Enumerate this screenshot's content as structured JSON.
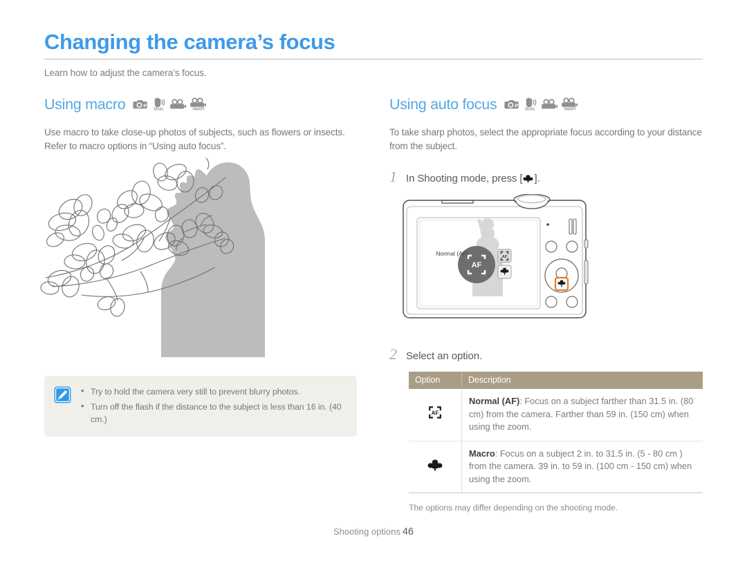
{
  "page": {
    "title": "Changing the camera’s focus",
    "subtitle": "Learn how to adjust the camera’s focus.",
    "accent_color": "#3d9ae9",
    "section_color": "#54a8e3",
    "table_header_color": "#a99d85",
    "note_bg_color": "#f1efe9",
    "highlight_color": "#f07820"
  },
  "mode_icons": [
    {
      "name": "camera-program-icon",
      "label": "P"
    },
    {
      "name": "dual-is-icon",
      "label": "DUAL"
    },
    {
      "name": "movie-icon",
      "label": ""
    },
    {
      "name": "smart-movie-icon",
      "label": "SMART"
    }
  ],
  "left": {
    "section_title": "Using macro",
    "body": "Use macro to take close-up photos of subjects, such as flowers or insects. Refer to macro options in “Using auto focus”.",
    "illustration": "magnolia-branch-with-photographer-silhouette",
    "note": {
      "icon": "note-pen-icon",
      "bullets": [
        "Try to hold the camera very still to prevent blurry photos.",
        "Turn off the flash if the distance to the subject is less than 16 in. (40 cm.)"
      ]
    }
  },
  "right": {
    "section_title": "Using auto focus",
    "body": "To take sharp photos, select the appropriate focus according to your distance from the subject.",
    "steps": [
      {
        "num": "1",
        "text_before": "In Shooting mode, press [",
        "icon": "macro-flower-icon",
        "text_after": "]."
      },
      {
        "num": "2",
        "text_before": "Select an option.",
        "icon": "",
        "text_after": ""
      }
    ],
    "camera": {
      "lcd_label": "Normal (AF)",
      "lcd_selected_icon": "af-frame-icon",
      "lcd_options": [
        "af-frame-icon",
        "macro-flower-icon"
      ],
      "highlighted_button": "macro-button",
      "highlighted_button_icon": "macro-flower-icon"
    },
    "table": {
      "headers": [
        "Option",
        "Description"
      ],
      "rows": [
        {
          "icon": "af-frame-icon",
          "name": "Normal (AF)",
          "separator": ": ",
          "description": "Focus on a subject farther than 31.5 in. (80 cm) from the camera. Farther than 59 in. (150 cm) when using the zoom."
        },
        {
          "icon": "macro-flower-icon",
          "name": "Macro",
          "separator": ": ",
          "description": "Focus on a subject 2 in. to 31.5 in. (5 - 80 cm ) from the camera. 39 in. to 59 in. (100 cm - 150 cm) when using the zoom."
        }
      ],
      "footnote": "The options may differ depending on the shooting mode."
    }
  },
  "footer": {
    "label": "Shooting options",
    "page_number": "46"
  }
}
